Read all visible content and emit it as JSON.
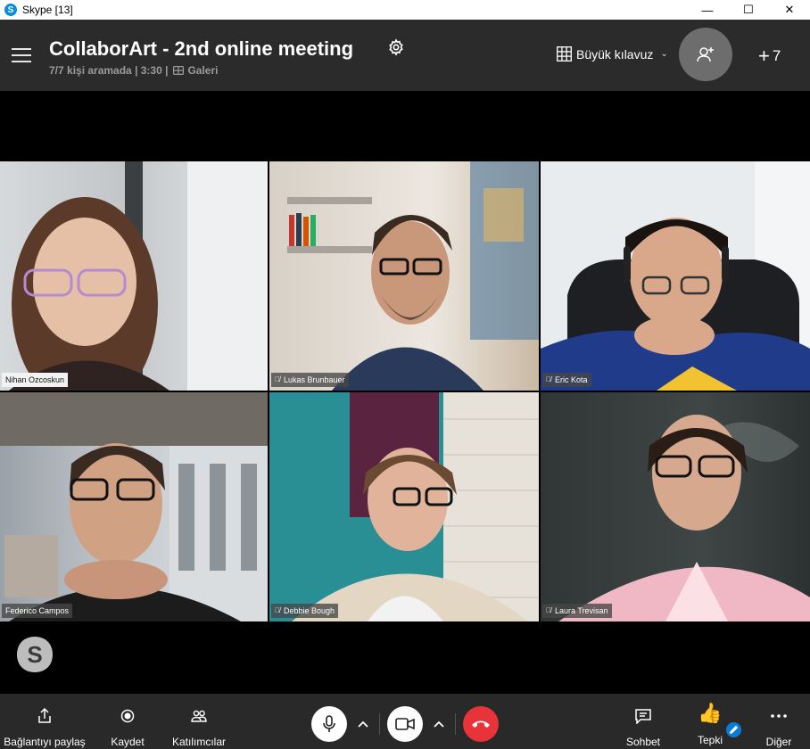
{
  "window": {
    "title": "Skype [13]",
    "minimize_glyph": "—",
    "maximize_glyph": "☐",
    "close_glyph": "✕"
  },
  "header": {
    "meeting_title": "CollaborArt - 2nd online meeting",
    "status": "7/7 kişi aramada | 3:30 |",
    "view_label": "Galeri",
    "layout_label": "Büyük kılavuz",
    "layout_chevron": "⌄",
    "more_participants_plus": "+",
    "more_participants_count": "7"
  },
  "participants": [
    {
      "name": "Nihan Ozcoskun",
      "muted": false,
      "tag_style": "light"
    },
    {
      "name": "Lukas Brunbauer",
      "muted": true,
      "tag_style": "dark"
    },
    {
      "name": "Eric Kota",
      "muted": true,
      "tag_style": "dark"
    },
    {
      "name": "Federico Campos",
      "muted": false,
      "tag_style": "dark"
    },
    {
      "name": "Debbie Bough",
      "muted": true,
      "tag_style": "dark"
    },
    {
      "name": "Laura Trevisan",
      "muted": true,
      "tag_style": "dark"
    }
  ],
  "mute_glyph": "🎙̸",
  "toolbar": {
    "share_label": "Bağlantıyı paylaş",
    "record_label": "Kaydet",
    "participants_label": "Katılımcılar",
    "chat_label": "Sohbet",
    "reaction_label": "Tepki",
    "more_label": "Diğer",
    "reaction_emoji": "👍"
  },
  "colors": {
    "header_bg": "#2b2b2b",
    "toolbar_bg": "#292929",
    "end_call": "#e8333a",
    "accent_blue": "#0a7bd8"
  }
}
